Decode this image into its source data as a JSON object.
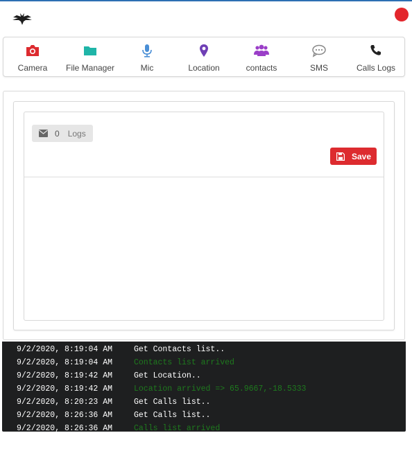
{
  "app": {
    "accent_color": "#2d6fb3",
    "logo_icon": "bird-logo-icon",
    "status_color": "#e3262c"
  },
  "toolbar": {
    "items": [
      {
        "label": "Camera",
        "icon": "camera-icon",
        "color": "#dd2b2f"
      },
      {
        "label": "File Manager",
        "icon": "folder-icon",
        "color": "#1fb5a8"
      },
      {
        "label": "Mic",
        "icon": "microphone-icon",
        "color": "#4a8fd6"
      },
      {
        "label": "Location",
        "icon": "map-marker-icon",
        "color": "#6f3fb5"
      },
      {
        "label": "contacts",
        "icon": "users-icon",
        "color": "#9b3fc8"
      },
      {
        "label": "SMS",
        "icon": "comment-dots-icon",
        "color": "#888888"
      },
      {
        "label": "Calls Logs",
        "icon": "phone-icon",
        "color": "#222222"
      }
    ]
  },
  "panel": {
    "logs_count": "0",
    "logs_label": "Logs",
    "save_label": "Save",
    "save_color": "#dd2b2f"
  },
  "console": {
    "lines": [
      {
        "time": "9/2/2020, 8:19:04 AM",
        "message": "Get Contacts list..",
        "status": "command"
      },
      {
        "time": "9/2/2020, 8:19:04 AM",
        "message": "Contacts list arrived",
        "status": "success"
      },
      {
        "time": "9/2/2020, 8:19:42 AM",
        "message": "Get Location..",
        "status": "command"
      },
      {
        "time": "9/2/2020, 8:19:42 AM",
        "message": "Location arrived => 65.9667,-18.5333",
        "status": "success"
      },
      {
        "time": "9/2/2020, 8:20:23 AM",
        "message": "Get Calls list..",
        "status": "command"
      },
      {
        "time": "9/2/2020, 8:26:36 AM",
        "message": "Get Calls list..",
        "status": "command"
      },
      {
        "time": "9/2/2020, 8:26:36 AM",
        "message": "Calls list arrived",
        "status": "success"
      }
    ]
  }
}
